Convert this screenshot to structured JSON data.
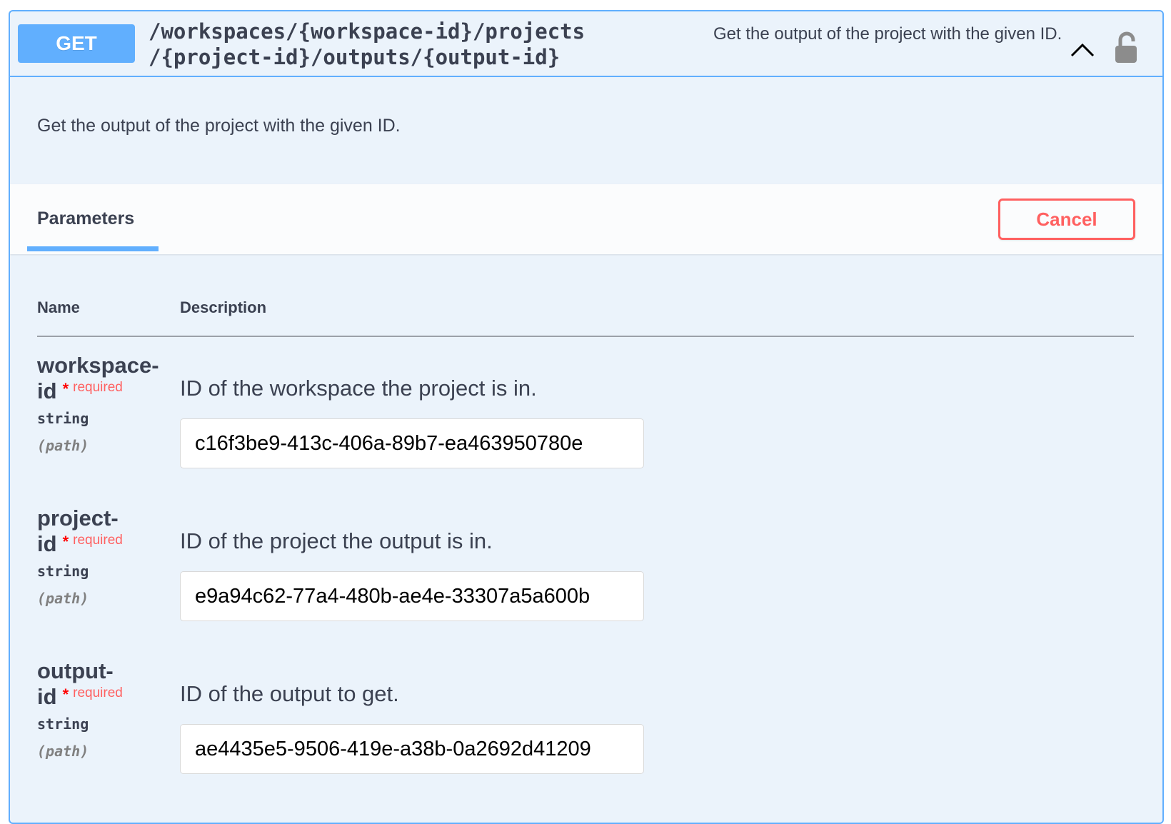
{
  "operation": {
    "method": "GET",
    "path_line1": "/workspaces/{workspace-id}/projects",
    "path_line2": "/{project-id}/outputs/{output-id}",
    "summary": "Get the output of the project with the given ID.",
    "description": "Get the output of the project with the given ID."
  },
  "section": {
    "tab_label": "Parameters",
    "cancel_label": "Cancel"
  },
  "table": {
    "col_name": "Name",
    "col_description": "Description"
  },
  "params": [
    {
      "name_part1": "workspace-",
      "name_part2": "id",
      "required_star": "*",
      "required_label": "required",
      "type": "string",
      "in": "(path)",
      "description": "ID of the workspace the project is in.",
      "value": "c16f3be9-413c-406a-89b7-ea463950780e"
    },
    {
      "name_part1": "project-",
      "name_part2": "id",
      "required_star": "*",
      "required_label": "required",
      "type": "string",
      "in": "(path)",
      "description": "ID of the project the output is in.",
      "value": "e9a94c62-77a4-480b-ae4e-33307a5a600b"
    },
    {
      "name_part1": "output-",
      "name_part2": "id",
      "required_star": "*",
      "required_label": "required",
      "type": "string",
      "in": "(path)",
      "description": "ID of the output to get.",
      "value": "ae4435e5-9506-419e-a38b-0a2692d41209"
    }
  ],
  "icons": {
    "collapse": "chevron-up-icon",
    "authorization": "lock-icon"
  },
  "colors": {
    "get_method": "#61affe",
    "cancel": "#ff6060",
    "required": "#ff0000",
    "panel_bg": "#ebf3fb"
  }
}
